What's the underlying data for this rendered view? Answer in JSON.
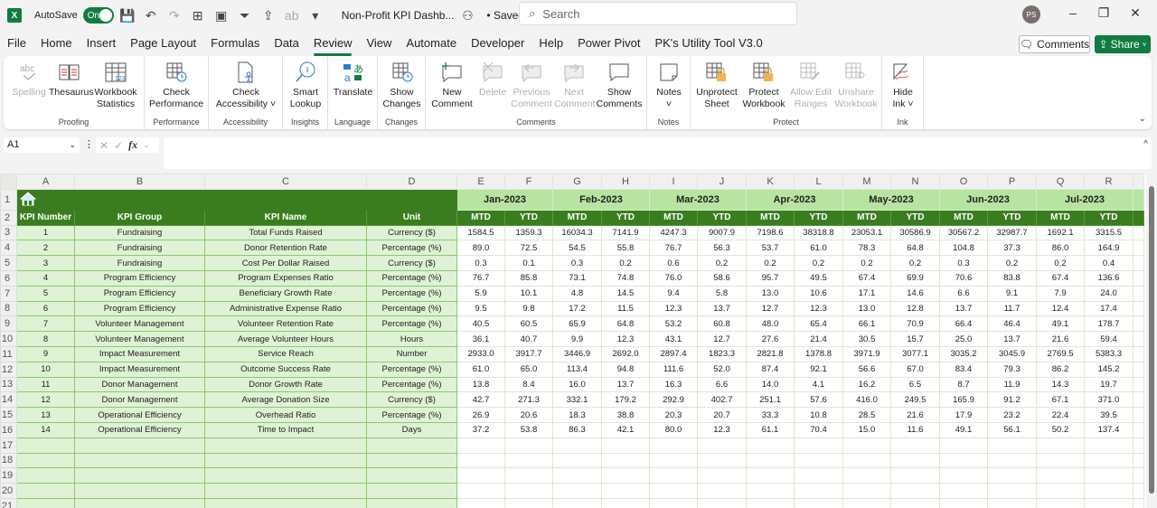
{
  "titlebar": {
    "app_icon": "X",
    "autosave_label": "AutoSave",
    "autosave_state": "On",
    "doc_title": "Non-Profit KPI Dashb...",
    "save_status": "• Saved",
    "search_placeholder": "Search",
    "user_initials": "PS"
  },
  "menu": {
    "tabs": [
      "File",
      "Home",
      "Insert",
      "Page Layout",
      "Formulas",
      "Data",
      "Review",
      "View",
      "Automate",
      "Developer",
      "Help",
      "Power Pivot",
      "PK's Utility Tool V3.0"
    ],
    "active_tab": "Review",
    "comments_label": "Comments",
    "share_label": "Share"
  },
  "ribbon": {
    "groups": {
      "proofing": "Proofing",
      "performance": "Performance",
      "accessibility": "Accessibility",
      "insights": "Insights",
      "language": "Language",
      "changes": "Changes",
      "comments": "Comments",
      "notes": "Notes",
      "protect": "Protect",
      "ink": "Ink"
    },
    "buttons": {
      "spelling": "Spelling",
      "thesaurus": "Thesaurus",
      "workbook_statistics_1": "Workbook",
      "workbook_statistics_2": "Statistics",
      "check_performance_1": "Check",
      "check_performance_2": "Performance",
      "check_accessibility_1": "Check",
      "check_accessibility_2": "Accessibility ˅",
      "smart_lookup_1": "Smart",
      "smart_lookup_2": "Lookup",
      "translate": "Translate",
      "show_changes_1": "Show",
      "show_changes_2": "Changes",
      "new_comment_1": "New",
      "new_comment_2": "Comment",
      "delete": "Delete",
      "previous_comment_1": "Previous",
      "previous_comment_2": "Comment",
      "next_comment_1": "Next",
      "next_comment_2": "Comment",
      "show_comments_1": "Show",
      "show_comments_2": "Comments",
      "notes_1": "Notes",
      "notes_2": "˅",
      "unprotect_sheet_1": "Unprotect",
      "unprotect_sheet_2": "Sheet",
      "protect_workbook_1": "Protect",
      "protect_workbook_2": "Workbook",
      "allow_edit_ranges_1": "Allow Edit",
      "allow_edit_ranges_2": "Ranges",
      "unshare_workbook_1": "Unshare",
      "unshare_workbook_2": "Workbook",
      "hide_ink_1": "Hide",
      "hide_ink_2": "Ink ˅"
    }
  },
  "formula_bar": {
    "name_box": "A1",
    "fx_label": "fx",
    "formula_value": ""
  },
  "sheet": {
    "columns": [
      "A",
      "B",
      "C",
      "D",
      "E",
      "F",
      "G",
      "H",
      "I",
      "J",
      "K",
      "L",
      "M",
      "N",
      "O",
      "P",
      "Q",
      "R"
    ],
    "row_numbers": [
      1,
      2,
      3,
      4,
      5,
      6,
      7,
      8,
      9,
      10,
      11,
      12,
      13,
      14,
      15,
      16,
      17,
      18,
      19,
      20,
      21
    ],
    "months": [
      "Jan-2023",
      "Feb-2023",
      "Mar-2023",
      "Apr-2023",
      "May-2023",
      "Jun-2023",
      "Jul-2023"
    ],
    "info_headers": [
      "KPI Number",
      "KPI Group",
      "KPI Name",
      "Unit"
    ],
    "mtd_label": "MTD",
    "ytd_label": "YTD",
    "colors": {
      "dark_green": "#3a7d1f",
      "light_green": "#dff2d5",
      "month_green": "#b7e4a2"
    },
    "rows": [
      {
        "num": "1",
        "group": "Fundraising",
        "name": "Total Funds Raised",
        "unit": "Currency ($)",
        "values": [
          "1584.5",
          "1359.3",
          "16034.3",
          "7141.9",
          "4247.3",
          "9007.9",
          "7198.6",
          "38318.8",
          "23053.1",
          "30586.9",
          "30567.2",
          "32987.7",
          "1692.1",
          "3315.5"
        ]
      },
      {
        "num": "2",
        "group": "Fundraising",
        "name": "Donor Retention Rate",
        "unit": "Percentage (%)",
        "values": [
          "89.0",
          "72.5",
          "54.5",
          "55.8",
          "76.7",
          "56.3",
          "53.7",
          "61.0",
          "78.3",
          "64.8",
          "104.8",
          "37.3",
          "86.0",
          "164.9"
        ]
      },
      {
        "num": "3",
        "group": "Fundraising",
        "name": "Cost Per Dollar Raised",
        "unit": "Currency ($)",
        "values": [
          "0.3",
          "0.1",
          "0.3",
          "0.2",
          "0.6",
          "0.2",
          "0.2",
          "0.2",
          "0.2",
          "0.2",
          "0.3",
          "0.2",
          "0.2",
          "0.4"
        ]
      },
      {
        "num": "4",
        "group": "Program Efficiency",
        "name": "Program Expenses Ratio",
        "unit": "Percentage (%)",
        "values": [
          "76.7",
          "85.8",
          "73.1",
          "74.8",
          "76.0",
          "58.6",
          "95.7",
          "49.5",
          "67.4",
          "69.9",
          "70.6",
          "83.8",
          "67.4",
          "136.6"
        ]
      },
      {
        "num": "5",
        "group": "Program Efficiency",
        "name": "Beneficiary Growth Rate",
        "unit": "Percentage (%)",
        "values": [
          "5.9",
          "10.1",
          "4.8",
          "14.5",
          "9.4",
          "5.8",
          "13.0",
          "10.6",
          "17.1",
          "14.6",
          "6.6",
          "9.1",
          "7.9",
          "24.0"
        ]
      },
      {
        "num": "6",
        "group": "Program Efficiency",
        "name": "Administrative Expense Ratio",
        "unit": "Percentage (%)",
        "values": [
          "9.5",
          "9.8",
          "17.2",
          "11.5",
          "12.3",
          "13.7",
          "12.7",
          "12.3",
          "13.0",
          "12.8",
          "13.7",
          "11.7",
          "12.4",
          "17.4"
        ]
      },
      {
        "num": "7",
        "group": "Volunteer Management",
        "name": "Volunteer Retention Rate",
        "unit": "Percentage (%)",
        "values": [
          "40.5",
          "60.5",
          "65.9",
          "64.8",
          "53.2",
          "60.8",
          "48.0",
          "65.4",
          "66.1",
          "70.9",
          "66.4",
          "46.4",
          "49.1",
          "178.7"
        ]
      },
      {
        "num": "8",
        "group": "Volunteer Management",
        "name": "Average Volunteer Hours",
        "unit": "Hours",
        "values": [
          "36.1",
          "40.7",
          "9.9",
          "12.3",
          "43.1",
          "12.7",
          "27.6",
          "21.4",
          "30.5",
          "15.7",
          "25.0",
          "13.7",
          "21.6",
          "59.4"
        ]
      },
      {
        "num": "9",
        "group": "Impact Measurement",
        "name": "Service Reach",
        "unit": "Number",
        "values": [
          "2933.0",
          "3917.7",
          "3446.9",
          "2692.0",
          "2897.4",
          "1823.3",
          "2821.8",
          "1378.8",
          "3971.9",
          "3077.1",
          "3035.2",
          "3045.9",
          "2769.5",
          "5383.3"
        ]
      },
      {
        "num": "10",
        "group": "Impact Measurement",
        "name": "Outcome Success Rate",
        "unit": "Percentage (%)",
        "values": [
          "61.0",
          "65.0",
          "113.4",
          "94.8",
          "111.6",
          "52.0",
          "87.4",
          "92.1",
          "56.6",
          "67.0",
          "83.4",
          "79.3",
          "86.2",
          "145.2"
        ]
      },
      {
        "num": "11",
        "group": "Donor Management",
        "name": "Donor Growth Rate",
        "unit": "Percentage (%)",
        "values": [
          "13.8",
          "8.4",
          "16.0",
          "13.7",
          "16.3",
          "6.6",
          "14.0",
          "4.1",
          "16.2",
          "6.5",
          "8.7",
          "11.9",
          "14.3",
          "19.7"
        ]
      },
      {
        "num": "12",
        "group": "Donor Management",
        "name": "Average Donation Size",
        "unit": "Currency ($)",
        "values": [
          "42.7",
          "271.3",
          "332.1",
          "179.2",
          "292.9",
          "402.7",
          "251.1",
          "57.6",
          "416.0",
          "249.5",
          "165.9",
          "91.2",
          "67.1",
          "371.0"
        ]
      },
      {
        "num": "13",
        "group": "Operational Efficiency",
        "name": "Overhead Ratio",
        "unit": "Percentage (%)",
        "values": [
          "26.9",
          "20.6",
          "18.3",
          "38.8",
          "20.3",
          "20.7",
          "33.3",
          "10.8",
          "28.5",
          "21.6",
          "17.9",
          "23.2",
          "22.4",
          "39.5"
        ]
      },
      {
        "num": "14",
        "group": "Operational Efficiency",
        "name": "Time to Impact",
        "unit": "Days",
        "values": [
          "37.2",
          "53.8",
          "86.3",
          "42.1",
          "80.0",
          "12.3",
          "61.1",
          "70.4",
          "15.0",
          "11.6",
          "49.1",
          "56.1",
          "50.2",
          "137.4"
        ]
      }
    ],
    "empty_rows": 5
  }
}
